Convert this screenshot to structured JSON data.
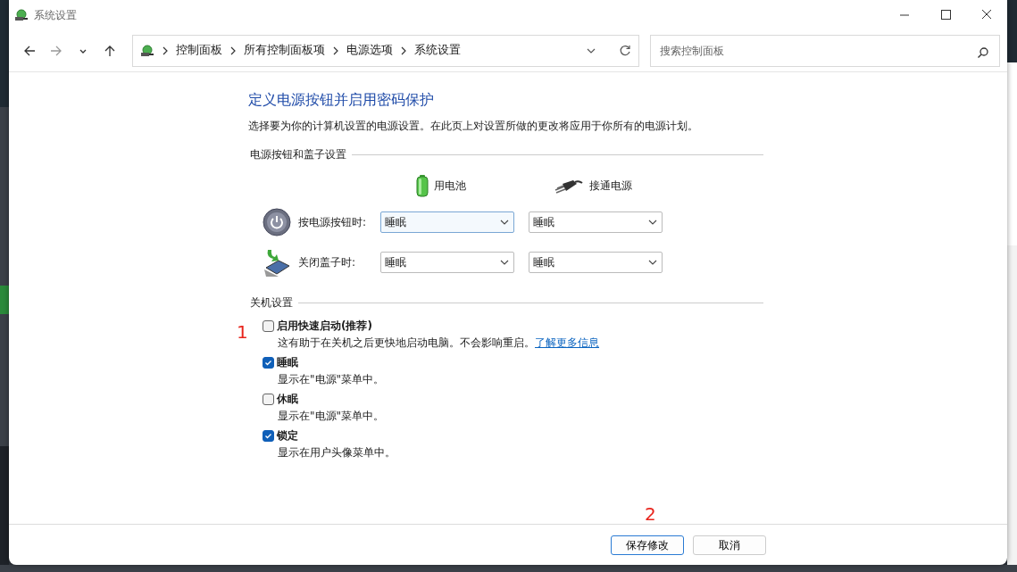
{
  "window": {
    "title": "系统设置"
  },
  "nav": {
    "breadcrumb": [
      "控制面板",
      "所有控制面板项",
      "电源选项",
      "系统设置"
    ],
    "search": {
      "placeholder": "搜索控制面板"
    }
  },
  "page": {
    "heading": "定义电源按钮并启用密码保护",
    "description": "选择要为你的计算机设置的电源设置。在此页上对设置所做的更改将应用于你所有的电源计划。"
  },
  "power_section": {
    "title": "电源按钮和盖子设置",
    "columns": [
      {
        "label": "用电池",
        "kind": "battery"
      },
      {
        "label": "接通电源",
        "kind": "plugged"
      }
    ],
    "rows": [
      {
        "kind": "power-button",
        "label": "按电源按钮时:",
        "settings": [
          {
            "value": "睡眠",
            "highlighted": true
          },
          {
            "value": "睡眠",
            "highlighted": false
          }
        ]
      },
      {
        "kind": "lid",
        "label": "关闭盖子时:",
        "settings": [
          {
            "value": "睡眠",
            "highlighted": false
          },
          {
            "value": "睡眠",
            "highlighted": false
          }
        ]
      }
    ]
  },
  "shutdown_section": {
    "title": "关机设置",
    "options": [
      {
        "label": "启用快速启动(推荐)",
        "checked": false,
        "description": "这有助于在关机之后更快地启动电脑。不会影响重启。",
        "link": "了解更多信息"
      },
      {
        "label": "睡眠",
        "checked": true,
        "description": "显示在\"电源\"菜单中。"
      },
      {
        "label": "休眠",
        "checked": false,
        "description": "显示在\"电源\"菜单中。"
      },
      {
        "label": "锁定",
        "checked": true,
        "description": "显示在用户头像菜单中。"
      }
    ]
  },
  "annotations": [
    {
      "text": "1",
      "kind": "options"
    },
    {
      "text": "2",
      "kind": "buttons"
    }
  ],
  "buttons": [
    {
      "label": "保存修改",
      "default": true
    },
    {
      "label": "取消",
      "default": false
    }
  ]
}
